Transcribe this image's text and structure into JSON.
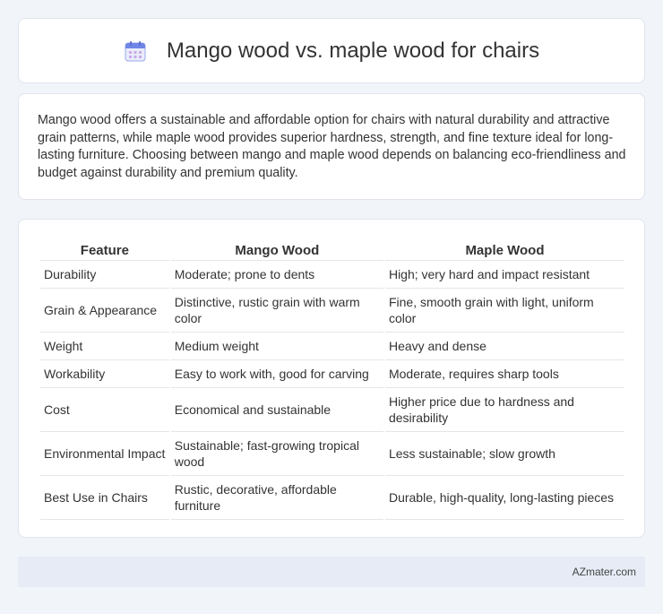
{
  "header": {
    "icon": "calendar-icon",
    "title": "Mango wood vs. maple wood for chairs"
  },
  "description": "Mango wood offers a sustainable and affordable option for chairs with natural durability and attractive grain patterns, while maple wood provides superior hardness, strength, and fine texture ideal for long-lasting furniture. Choosing between mango and maple wood depends on balancing eco-friendliness and budget against durability and premium quality.",
  "table": {
    "headers": [
      "Feature",
      "Mango Wood",
      "Maple Wood"
    ],
    "rows": [
      [
        "Durability",
        "Moderate; prone to dents",
        "High; very hard and impact resistant"
      ],
      [
        "Grain & Appearance",
        "Distinctive, rustic grain with warm color",
        "Fine, smooth grain with light, uniform color"
      ],
      [
        "Weight",
        "Medium weight",
        "Heavy and dense"
      ],
      [
        "Workability",
        "Easy to work with, good for carving",
        "Moderate, requires sharp tools"
      ],
      [
        "Cost",
        "Economical and sustainable",
        "Higher price due to hardness and desirability"
      ],
      [
        "Environmental Impact",
        "Sustainable; fast-growing tropical wood",
        "Less sustainable; slow growth"
      ],
      [
        "Best Use in Chairs",
        "Rustic, decorative, affordable furniture",
        "Durable, high-quality, long-lasting pieces"
      ]
    ]
  },
  "footer": {
    "brand": "AZmater.com"
  },
  "colors": {
    "background": "#f1f4f9",
    "card": "#ffffff",
    "footer": "#e6ebf5",
    "icon_accent": "#7b8fe0"
  }
}
